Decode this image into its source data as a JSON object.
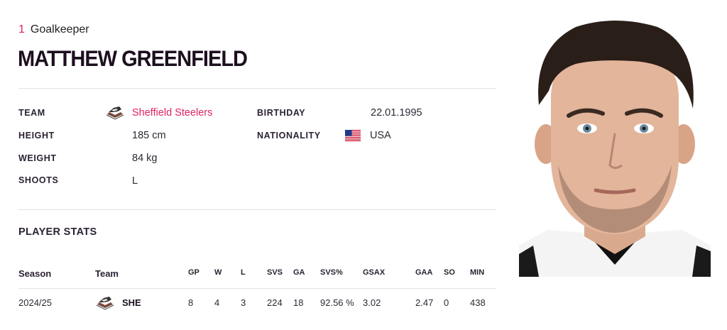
{
  "header": {
    "jersey_number": "1",
    "position": "Goalkeeper",
    "player_name": "MATTHEW GREENFIELD"
  },
  "profile": {
    "team_label": "TEAM",
    "team_value": "Sheffield Steelers",
    "height_label": "HEIGHT",
    "height_value": "185 cm",
    "weight_label": "WEIGHT",
    "weight_value": "84 kg",
    "shoots_label": "SHOOTS",
    "shoots_value": "L",
    "birthday_label": "BIRTHDAY",
    "birthday_value": "22.01.1995",
    "nationality_label": "NATIONALITY",
    "nationality_value": "USA"
  },
  "stats": {
    "title": "PLAYER STATS",
    "columns": [
      "Season",
      "Team",
      "GP",
      "W",
      "L",
      "SVS",
      "GA",
      "SVS%",
      "GSAX",
      "GAA",
      "SO",
      "MIN"
    ],
    "rows": [
      {
        "season": "2024/25",
        "team": "SHE",
        "gp": "8",
        "w": "4",
        "l": "3",
        "svs": "224",
        "ga": "18",
        "svs_pct": "92.56 %",
        "gsax": "3.02",
        "gaa": "2.47",
        "so": "0",
        "min": "438"
      }
    ]
  },
  "colors": {
    "accent": "#e0245e",
    "name": "#1d0f1f",
    "divider": "#e2e2e6"
  },
  "icons": {
    "team_logo": "sheffield-steelers-logo",
    "flag": "usa-flag-icon"
  }
}
